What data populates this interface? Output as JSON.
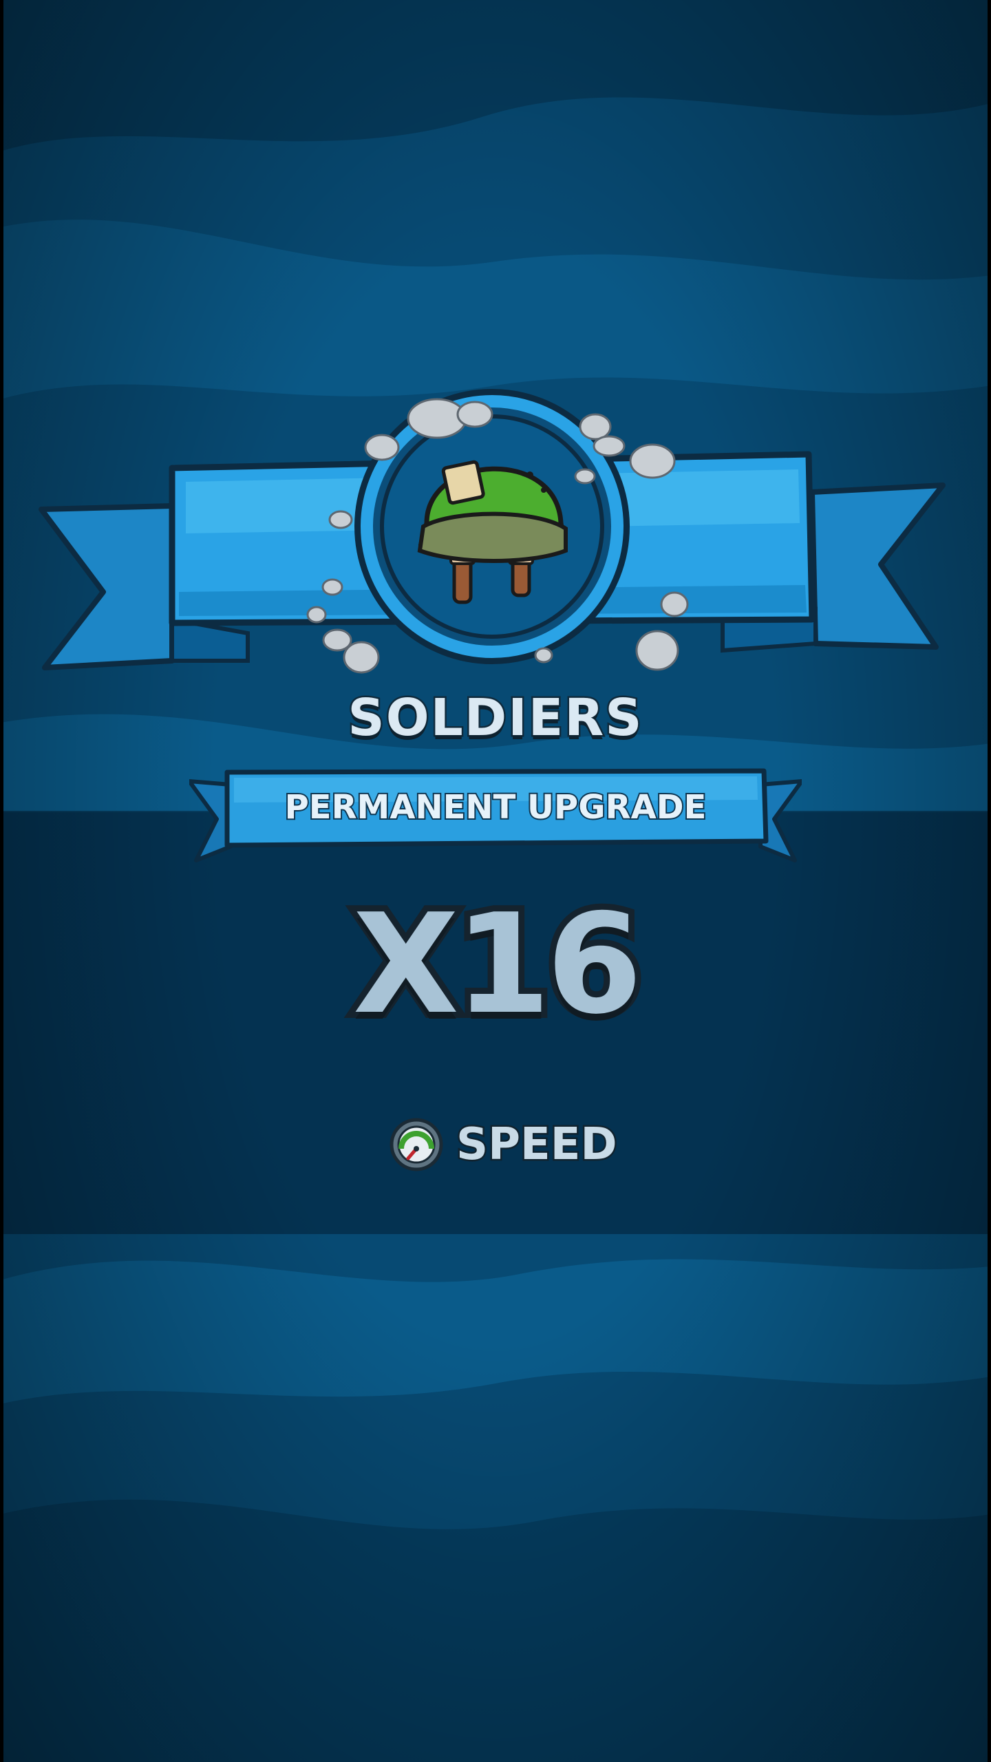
{
  "reward": {
    "title": "SOLDIERS",
    "ribbon_label": "PERMANENT UPGRADE",
    "multiplier": "X16",
    "stat_label": "SPEED",
    "icons": {
      "emblem": "army-helmet-icon",
      "stat": "speedometer-icon"
    }
  },
  "colors": {
    "background": "#07456d",
    "ribbon": "#2aa3e6",
    "ribbon_dark": "#0b6fae",
    "helmet": "#4cae2f",
    "text_light": "#dbe9f3",
    "multiplier_text": "#a8c3d6"
  }
}
